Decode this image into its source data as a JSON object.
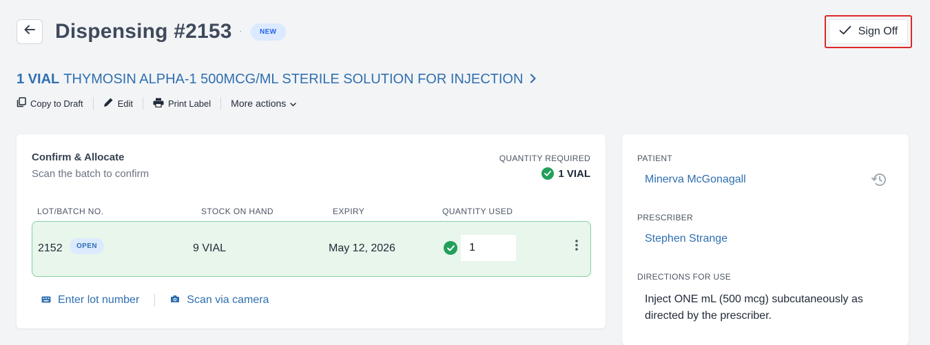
{
  "header": {
    "title": "Dispensing #2153",
    "separator": "·",
    "status_badge": "NEW",
    "sign_off_label": "Sign Off"
  },
  "medication": {
    "quantity": "1 VIAL",
    "name": "THYMOSIN ALPHA-1 500MCG/ML STERILE SOLUTION FOR INJECTION"
  },
  "actions": {
    "copy_to_draft": "Copy to Draft",
    "edit": "Edit",
    "print_label": "Print Label",
    "more_actions": "More actions"
  },
  "confirm": {
    "title": "Confirm & Allocate",
    "subtitle": "Scan the batch to confirm",
    "qty_required_label": "QUANTITY REQUIRED",
    "qty_required_value": "1 VIAL",
    "columns": [
      "LOT/BATCH NO.",
      "STOCK ON HAND",
      "EXPIRY",
      "QUANTITY USED"
    ],
    "batch": {
      "lot": "2152",
      "status": "OPEN",
      "stock": "9 VIAL",
      "expiry": "May 12, 2026",
      "quantity_used": "1"
    },
    "enter_lot": "Enter lot number",
    "scan_camera": "Scan via camera"
  },
  "details": {
    "patient_label": "PATIENT",
    "patient_name": "Minerva McGonagall",
    "prescriber_label": "PRESCRIBER",
    "prescriber_name": "Stephen Strange",
    "directions_label": "DIRECTIONS FOR USE",
    "directions": "Inject ONE mL (500 mcg) subcutaneously as directed by the prescriber."
  },
  "colors": {
    "accent_blue": "#2f6fb0",
    "success_green": "#22a05b",
    "highlight_red": "#dc2626"
  }
}
